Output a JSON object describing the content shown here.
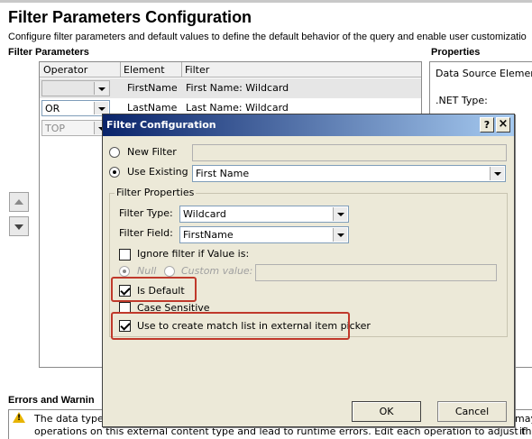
{
  "page": {
    "title": "Filter Parameters Configuration",
    "description": "Configure filter parameters and default values to define the default behavior of the query and enable user customizatio",
    "filter_parameters_label": "Filter Parameters",
    "properties_label": "Properties"
  },
  "grid": {
    "columns": [
      "Operator",
      "Element",
      "Filter"
    ],
    "rows": [
      {
        "operator": "",
        "element": "FirstName",
        "filter": "First Name: Wildcard"
      },
      {
        "operator": "OR",
        "element": "LastName",
        "filter": "Last Name: Wildcard"
      },
      {
        "operator": "TOP",
        "element": "",
        "filter": ""
      }
    ]
  },
  "properties": {
    "data_source_element": "Data Source Element:",
    "net_type": ".NET Type:"
  },
  "errors": {
    "label": "Errors and Warnin",
    "line1_left": "The data type c",
    "line1_right": "may",
    "line2": "operations on this external content type and lead to runtime errors. Edit each operation to adjust the data types",
    "line2_right": "if"
  },
  "dialog": {
    "title": "Filter Configuration",
    "help_glyph": "?",
    "close_glyph": "×",
    "new_filter_label": "New Filter",
    "new_filter_value": "",
    "use_existing_label": "Use Existing",
    "use_existing_value": "First Name",
    "group_label": "Filter Properties",
    "filter_type_label": "Filter Type:",
    "filter_type_value": "Wildcard",
    "filter_field_label": "Filter Field:",
    "filter_field_value": "FirstName",
    "ignore_filter_label": "Ignore filter if Value is:",
    "null_label": "Null",
    "custom_value_label": "Custom value:",
    "custom_value": "",
    "is_default_label": "Is Default",
    "case_sensitive_label": "Case Sensitive",
    "match_list_label": "Use to create match list in external item picker",
    "ok_label": "OK",
    "cancel_label": "Cancel",
    "title_bar_colors": [
      "#0a246a",
      "#a6caf0"
    ],
    "highlight_color": "#c0392b"
  }
}
